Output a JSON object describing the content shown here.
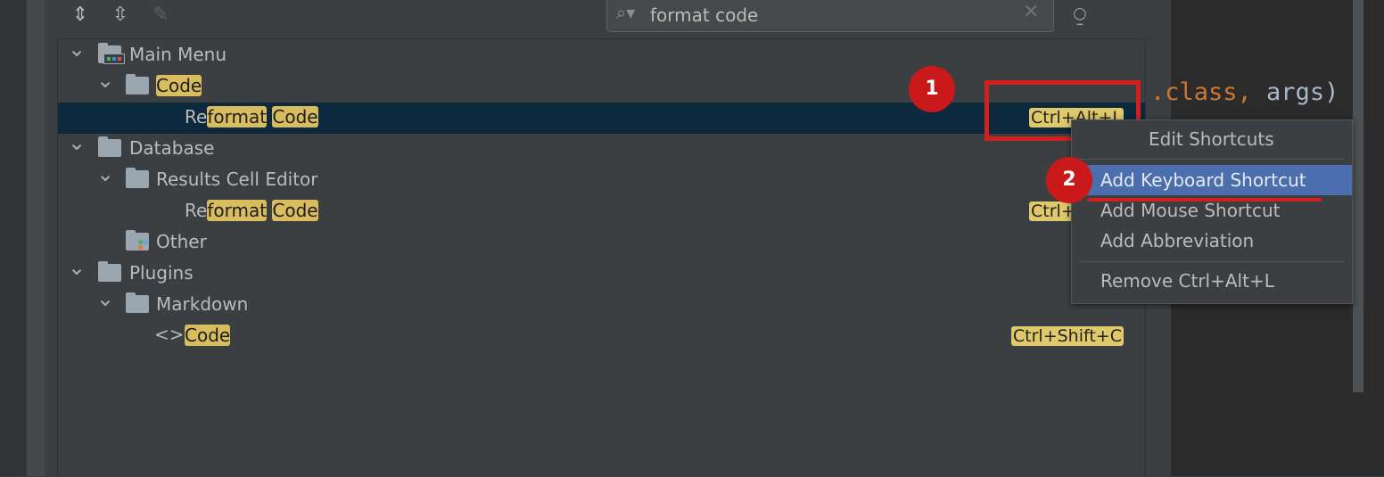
{
  "toolbar": {
    "expand_all_icon": "expand-all-icon",
    "collapse_all_icon": "collapse-all-icon",
    "edit_icon": "pencil-icon"
  },
  "search": {
    "value": "format code",
    "clear_icon": "close-icon",
    "find_by_shortcut_icon": "find-shortcut-icon"
  },
  "tree": [
    {
      "level": 0,
      "expanded": true,
      "icon": "main-menu-folder",
      "segments": [
        {
          "t": "Main Menu",
          "hl": false
        }
      ],
      "shortcut": ""
    },
    {
      "level": 1,
      "expanded": true,
      "icon": "folder",
      "segments": [
        {
          "t": "Code",
          "hl": true
        }
      ],
      "shortcut": ""
    },
    {
      "level": 2,
      "icon": "none",
      "selected": true,
      "segments": [
        {
          "t": "Re",
          "hl": false
        },
        {
          "t": "format",
          "hl": true
        },
        {
          "t": " ",
          "hl": false
        },
        {
          "t": "Code",
          "hl": true
        }
      ],
      "shortcut": "Ctrl+Alt+L"
    },
    {
      "level": 0,
      "expanded": true,
      "icon": "folder",
      "segments": [
        {
          "t": "Database",
          "hl": false
        }
      ],
      "shortcut": ""
    },
    {
      "level": 1,
      "expanded": true,
      "icon": "folder",
      "segments": [
        {
          "t": "Results Cell Editor",
          "hl": false
        }
      ],
      "shortcut": ""
    },
    {
      "level": 2,
      "icon": "none",
      "segments": [
        {
          "t": "Re",
          "hl": false
        },
        {
          "t": "format",
          "hl": true
        },
        {
          "t": " ",
          "hl": false
        },
        {
          "t": "Code",
          "hl": true
        }
      ],
      "shortcut": "Ctrl+Alt+L"
    },
    {
      "level": 1,
      "icon": "other-folder",
      "segments": [
        {
          "t": "Other",
          "hl": false
        }
      ],
      "shortcut": ""
    },
    {
      "level": 0,
      "expanded": true,
      "icon": "folder",
      "segments": [
        {
          "t": "Plugins",
          "hl": false
        }
      ],
      "shortcut": ""
    },
    {
      "level": 1,
      "expanded": true,
      "icon": "folder",
      "segments": [
        {
          "t": "Markdown",
          "hl": false
        }
      ],
      "shortcut": ""
    },
    {
      "level": 1,
      "icon": "code-brackets",
      "segments": [
        {
          "t": "Code",
          "hl": true
        }
      ],
      "shortcut": "Ctrl+Shift+C"
    }
  ],
  "context_menu": {
    "items": [
      "Edit Shortcuts",
      "Add Keyboard Shortcut",
      "Add Mouse Shortcut",
      "Add Abbreviation",
      "Remove Ctrl+Alt+L"
    ],
    "active_index": 1
  },
  "annotations": {
    "step1": "1",
    "step2": "2",
    "highlight_color": "#d3201e"
  },
  "editor": {
    "code_keyword": ".class,",
    "code_text": " args)"
  },
  "colors": {
    "selection": "#0d293e",
    "menu_active": "#4b6eaf",
    "match_highlight": "#d9bc5d"
  }
}
